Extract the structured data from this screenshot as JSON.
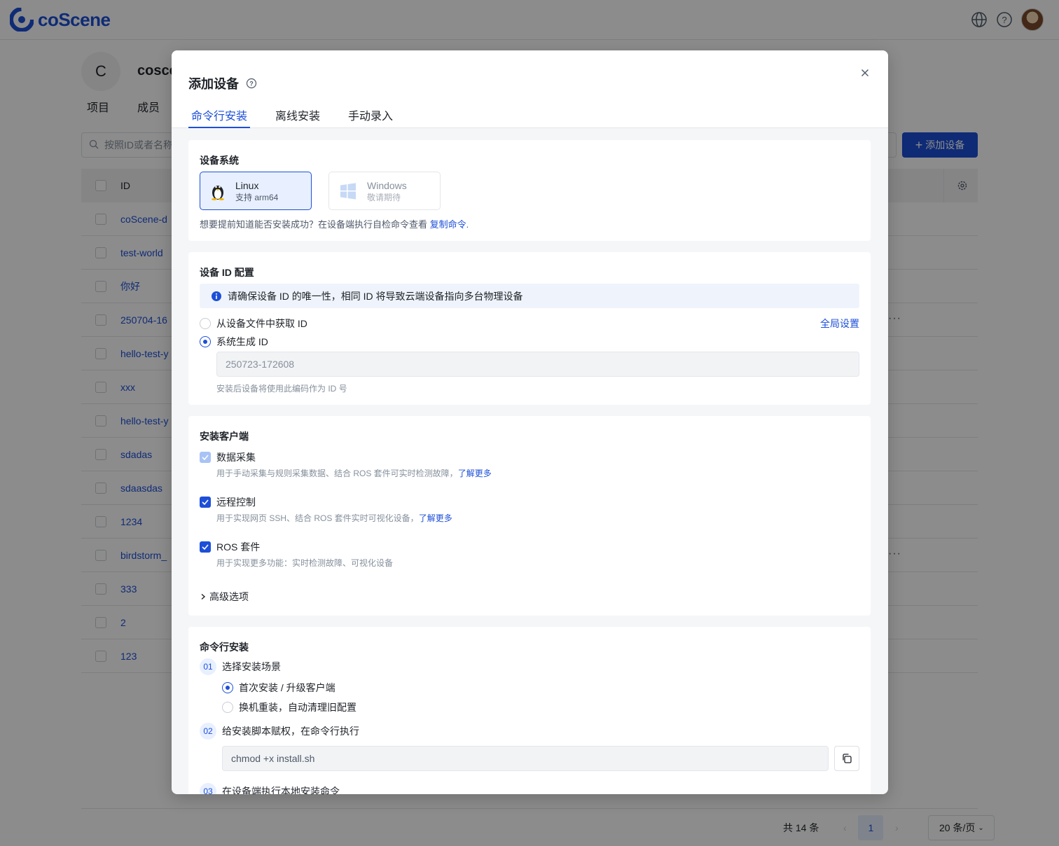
{
  "app": {
    "brand": "coScene",
    "org_initial": "C",
    "org_name": "cosce",
    "org_tabs": [
      "项目",
      "成员"
    ],
    "search_placeholder": "按照ID或者名称",
    "add_device_label": "添加设备",
    "table_header_id": "ID",
    "rows": [
      "coScene-d",
      "test-world",
      "你好",
      "250704-16",
      "hello-test-y",
      "xxx",
      "hello-test-y",
      "sdadas",
      "sdaasdas",
      "1234",
      "birdstorm_",
      "333",
      "2",
      "123"
    ],
    "row_more": "···",
    "pagination": {
      "total": "共 14 条",
      "current_page": "1",
      "page_size": "20 条/页"
    }
  },
  "modal": {
    "title": "添加设备",
    "tabs": [
      "命令行安装",
      "离线安装",
      "手动录入"
    ],
    "active_tab": 0,
    "os_section": {
      "title": "设备系统",
      "linux_name": "Linux",
      "linux_sub": "支持 arm64",
      "windows_name": "Windows",
      "windows_sub": "敬请期待",
      "hint": "想要提前知道能否安装成功？在设备端执行自检命令查看",
      "hint_link": "复制命令",
      "hint_end": "."
    },
    "id_section": {
      "title": "设备 ID 配置",
      "info": "请确保设备 ID 的唯一性，相同 ID 将导致云端设备指向多台物理设备",
      "opt_file": "从设备文件中获取 ID",
      "opt_system": "系统生成 ID",
      "global_link": "全局设置",
      "generated_id": "250723-172608",
      "note": "安装后设备将使用此编码作为 ID 号"
    },
    "client_section": {
      "title": "安装客户端",
      "items": [
        {
          "label": "数据采集",
          "desc": "用于手动采集与规则采集数据、结合 ROS 套件可实时检测故障，",
          "link": "了解更多"
        },
        {
          "label": "远程控制",
          "desc": "用于实现网页 SSH、结合 ROS 套件实时可视化设备，",
          "link": "了解更多"
        },
        {
          "label": "ROS 套件",
          "desc": "用于实现更多功能：实时检测故障、可视化设备",
          "link": ""
        }
      ],
      "advanced": "高级选项"
    },
    "cmd_section": {
      "title": "命令行安装",
      "step1_num": "01",
      "step1": "选择安装场景",
      "scene_first": "首次安装 / 升级客户端",
      "scene_reinstall": "换机重装，自动清理旧配置",
      "step2_num": "02",
      "step2": "给安装脚本赋权，在命令行执行",
      "chmod": "chmod +x install.sh",
      "step3_num": "03",
      "step3": "在设备端执行本地安装命令"
    }
  },
  "colors": {
    "primary": "#1d4fd8",
    "info_bg": "#eff4fc",
    "overlay": "rgba(0,0,0,0.45)"
  }
}
